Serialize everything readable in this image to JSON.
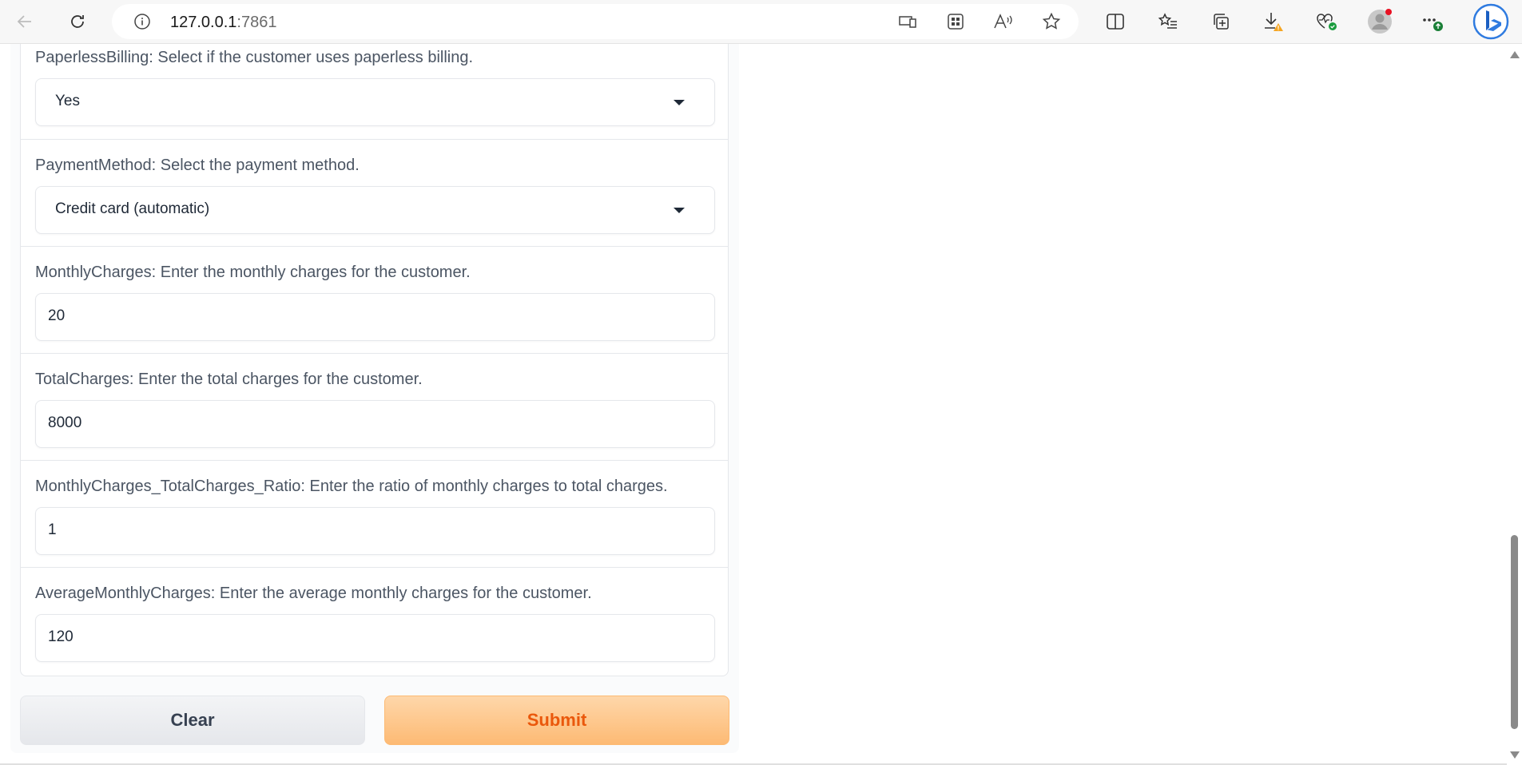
{
  "browser": {
    "url_host": "127.0.0.1",
    "url_port": ":7861",
    "icons": {
      "back": "back-arrow-icon",
      "refresh": "refresh-icon",
      "site_info": "info-icon",
      "app_available": "app-available-icon",
      "qr": "qr-code-icon",
      "read_aloud": "read-aloud-icon",
      "favorite": "star-icon",
      "split_screen": "split-screen-icon",
      "favorites": "favorites-icon",
      "collections": "collections-icon",
      "downloads": "download-icon",
      "performance": "browser-essentials-icon",
      "profile": "profile-avatar-icon",
      "more": "more-icon",
      "copilot": "bing-copilot-icon"
    }
  },
  "form": {
    "fields": [
      {
        "label": "PaperlessBilling: Select if the customer uses paperless billing.",
        "value": "Yes",
        "type": "dropdown"
      },
      {
        "label": "PaymentMethod: Select the payment method.",
        "value": "Credit card (automatic)",
        "type": "dropdown"
      },
      {
        "label": "MonthlyCharges: Enter the monthly charges for the customer.",
        "value": "20",
        "type": "number"
      },
      {
        "label": "TotalCharges: Enter the total charges for the customer.",
        "value": "8000",
        "type": "number"
      },
      {
        "label": "MonthlyCharges_TotalCharges_Ratio: Enter the ratio of monthly charges to total charges.",
        "value": "1",
        "type": "number"
      },
      {
        "label": "AverageMonthlyCharges: Enter the average monthly charges for the customer.",
        "value": "120",
        "type": "number"
      }
    ],
    "clear_label": "Clear",
    "submit_label": "Submit"
  },
  "colors": {
    "submit_text": "#ea580c",
    "submit_bg": "#fdba74",
    "clear_bg": "#e5e7eb"
  }
}
